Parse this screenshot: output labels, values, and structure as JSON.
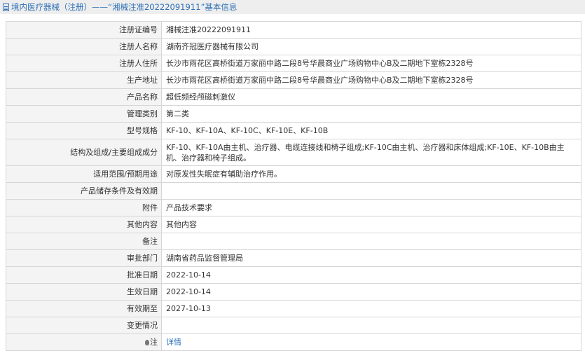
{
  "header": {
    "title": "境内医疗器械（注册）——“湘械注准20222091911”基本信息"
  },
  "fields": [
    {
      "label": "注册证编号",
      "value": "湘械注准20222091911"
    },
    {
      "label": "注册人名称",
      "value": "湖南齐冠医疗器械有限公司"
    },
    {
      "label": "注册人住所",
      "value": "长沙市雨花区高桥街道万家丽中路二段8号华晨商业广场购物中心B及二期地下室栋2328号"
    },
    {
      "label": "生产地址",
      "value": "长沙市雨花区高桥街道万家丽中路二段8号华晨商业广场购物中心B及二期地下室栋2328号"
    },
    {
      "label": "产品名称",
      "value": "超低频经颅磁刺激仪"
    },
    {
      "label": "管理类别",
      "value": "第二类"
    },
    {
      "label": "型号规格",
      "value": "KF-10、KF-10A、KF-10C、KF-10E、KF-10B"
    },
    {
      "label": "结构及组成/主要组成成分",
      "value": "KF-10、KF-10A由主机、治疗器、电缆连接线和椅子组成;KF-10C由主机、治疗器和床体组成;KF-10E、KF-10B由主机、治疗器和椅子组成。"
    },
    {
      "label": "适用范围/预期用途",
      "value": "对原发性失眠症有辅助治疗作用。"
    },
    {
      "label": "产品储存条件及有效期",
      "value": ""
    },
    {
      "label": "附件",
      "value": "产品技术要求"
    },
    {
      "label": "其他内容",
      "value": "其他内容"
    },
    {
      "label": "备注",
      "value": ""
    },
    {
      "label": "审批部门",
      "value": "湖南省药品监督管理局"
    },
    {
      "label": "批准日期",
      "value": "2022-10-14"
    },
    {
      "label": "生效日期",
      "value": "2022-10-14"
    },
    {
      "label": "有效期至",
      "value": "2027-10-13"
    },
    {
      "label": "变更情况",
      "value": ""
    }
  ],
  "note": {
    "label": "注",
    "link_text": "详情",
    "icon": "lightbulb-icon"
  }
}
